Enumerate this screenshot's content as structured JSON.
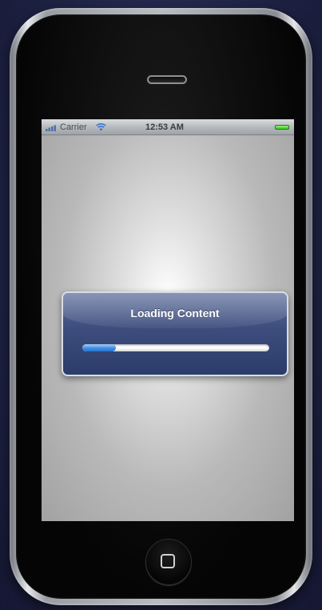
{
  "status_bar": {
    "carrier": "Carrier",
    "time": "12:53 AM",
    "signal_icon": "signal-bars-icon",
    "wifi_icon": "wifi-icon",
    "battery_icon": "battery-icon",
    "battery_color": "#36c51b"
  },
  "alert": {
    "title": "Loading Content",
    "progress_fraction": 0.18,
    "accent_color": "#3c4d7d"
  },
  "device": {
    "home_button_icon": "home-square-icon"
  }
}
